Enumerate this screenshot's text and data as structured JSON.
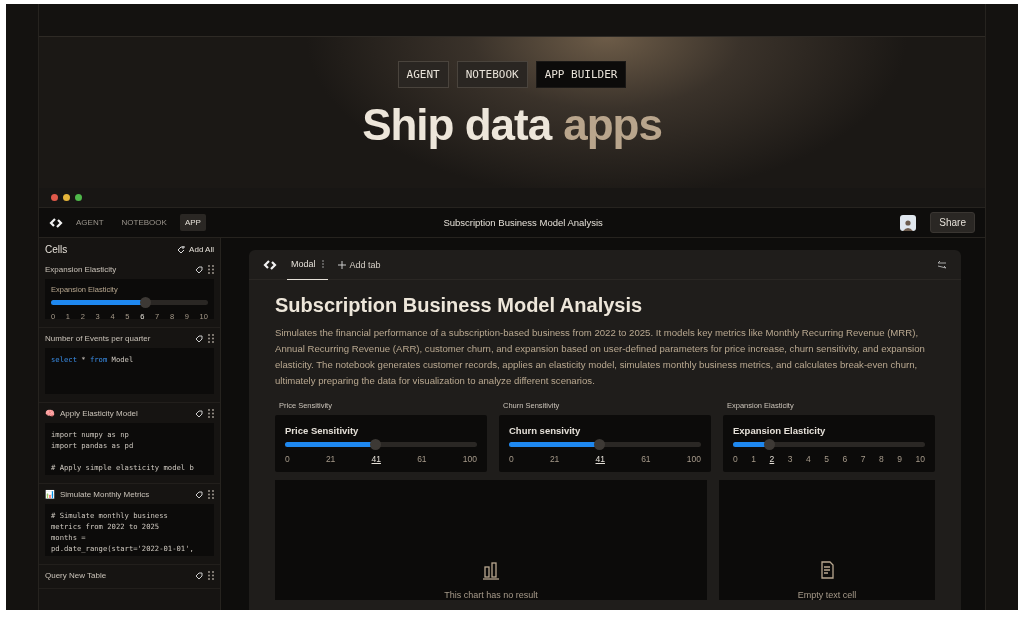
{
  "hero": {
    "modes": [
      {
        "label": "AGENT",
        "selected": false
      },
      {
        "label": "NOTEBOOK",
        "selected": false
      },
      {
        "label": "APP BUILDER",
        "selected": true
      }
    ],
    "headline_start": "Ship data",
    "headline_end": "apps"
  },
  "topbar": {
    "modes": [
      {
        "label": "AGENT",
        "selected": false
      },
      {
        "label": "NOTEBOOK",
        "selected": false
      },
      {
        "label": "APP",
        "selected": true
      }
    ],
    "title": "Subscription Business Model Analysis",
    "share": "Share"
  },
  "sidebar": {
    "title": "Cells",
    "add_all": "Add All",
    "cells": [
      {
        "kind": "slider",
        "title": "Expansion Elasticity",
        "slider": {
          "label": "Expansion Elasticity",
          "level": 0.6,
          "ticks": [
            {
              "label": "0",
              "selected": false
            },
            {
              "label": "1",
              "selected": false
            },
            {
              "label": "2",
              "selected": false
            },
            {
              "label": "3",
              "selected": false
            },
            {
              "label": "4",
              "selected": false
            },
            {
              "label": "5",
              "selected": false
            },
            {
              "label": "6",
              "selected": true
            },
            {
              "label": "7",
              "selected": false
            },
            {
              "label": "8",
              "selected": false
            },
            {
              "label": "9",
              "selected": false
            },
            {
              "label": "10",
              "selected": false
            }
          ]
        }
      },
      {
        "kind": "sql",
        "title": "Number of Events per quarter",
        "code": [
          {
            "text": "select",
            "keyword": true
          },
          {
            "text": " * ",
            "keyword": false
          },
          {
            "text": "from",
            "keyword": true
          },
          {
            "text": " Model",
            "keyword": false
          }
        ]
      },
      {
        "kind": "python",
        "title": "Apply Elasticity Model",
        "emoji": "🧠",
        "source": "import numpy as np\nimport pandas as pd\n\n# Apply simple elasticity model b"
      },
      {
        "kind": "python",
        "title": "Simulate Monthly Metrics",
        "emoji": "📊",
        "source": "# Simulate monthly business\nmetrics from 2022 to 2025\nmonths =\npd.date_range(start='2022-01-01',"
      },
      {
        "kind": "header",
        "title": "Query New Table"
      }
    ]
  },
  "app": {
    "tabs": [
      {
        "label": "Modal",
        "selected": true
      }
    ],
    "add_tab": "Add tab",
    "title": "Subscription Business Model Analysis",
    "description": "Simulates the financial performance of a subscription-based business from 2022 to 2025. It models key metrics like Monthly Recurring Revenue (MRR), Annual Recurring Revenue (ARR), customer churn, and expansion based on user-defined parameters for price increase, churn sensitivity, and expansion elasticity. The notebook generates customer records, applies an elasticity model, simulates monthly business metrics, and calculates break-even churn, ultimately preparing the data for visualization to analyze different scenarios.",
    "inputs": [
      {
        "caption": "Price Sensitivity",
        "label": "Price Sensitivity",
        "level": 0.47,
        "ticks": [
          {
            "label": "0",
            "selected": false
          },
          {
            "label": "21",
            "selected": false
          },
          {
            "label": "41",
            "selected": true
          },
          {
            "label": "61",
            "selected": false
          },
          {
            "label": "100",
            "selected": false
          }
        ]
      },
      {
        "caption": "Churn Sensitivity",
        "label": "Churn sensivity",
        "level": 0.47,
        "ticks": [
          {
            "label": "0",
            "selected": false
          },
          {
            "label": "21",
            "selected": false
          },
          {
            "label": "41",
            "selected": true
          },
          {
            "label": "61",
            "selected": false
          },
          {
            "label": "100",
            "selected": false
          }
        ]
      },
      {
        "caption": "Expansion Elasticity",
        "label": "Expansion Elasticity",
        "level": 0.19,
        "ticks": [
          {
            "label": "0",
            "selected": false
          },
          {
            "label": "1",
            "selected": false
          },
          {
            "label": "2",
            "selected": true
          },
          {
            "label": "3",
            "selected": false
          },
          {
            "label": "4",
            "selected": false
          },
          {
            "label": "5",
            "selected": false
          },
          {
            "label": "6",
            "selected": false
          },
          {
            "label": "7",
            "selected": false
          },
          {
            "label": "8",
            "selected": false
          },
          {
            "label": "9",
            "selected": false
          },
          {
            "label": "10",
            "selected": false
          }
        ]
      }
    ],
    "panels": [
      {
        "kind": "chart",
        "message": "This chart has no result"
      },
      {
        "kind": "text",
        "message": "Empty text cell"
      }
    ]
  }
}
